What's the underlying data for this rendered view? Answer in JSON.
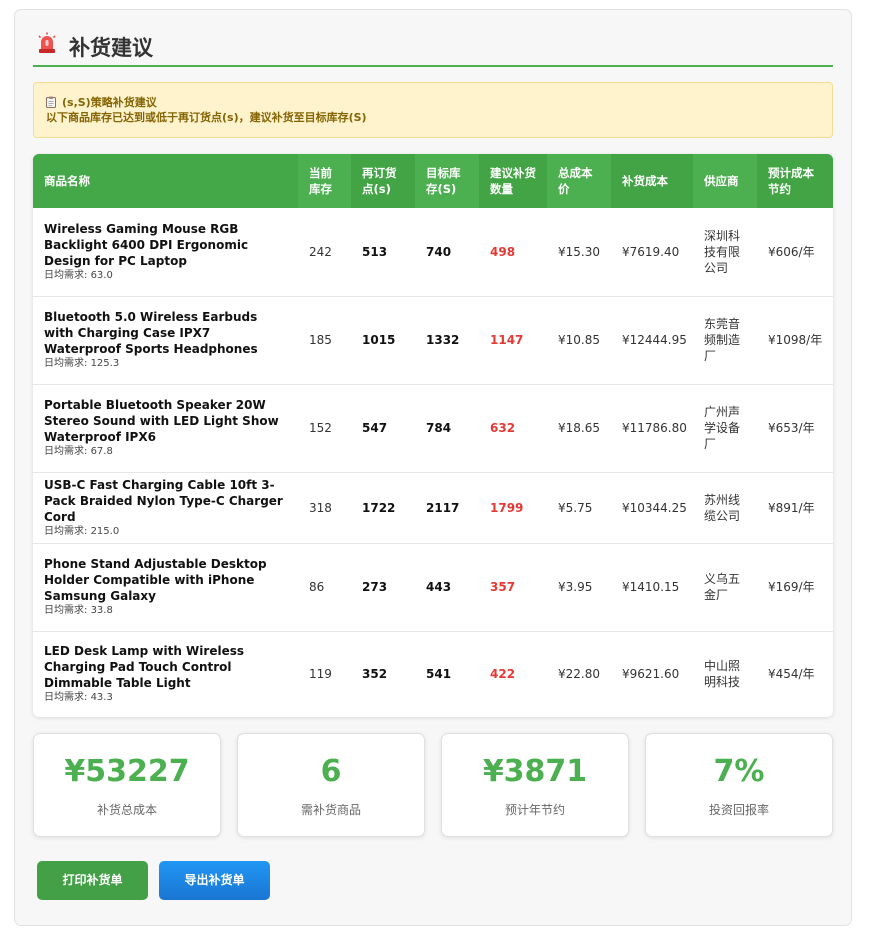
{
  "header": {
    "title": "补货建议",
    "icon": "alarm-light-icon"
  },
  "notice": {
    "icon": "clipboard-icon",
    "line1": "(s,S)策略补货建议",
    "line2": "以下商品库存已达到或低于再订货点(s)，建议补货至目标库存(S)"
  },
  "table": {
    "headers": [
      "商品名称",
      "当前库存",
      "再订货点(s)",
      "目标库存(S)",
      "建议补货数量",
      "总成本价",
      "补货成本",
      "供应商",
      "预计成本节约"
    ],
    "demand_label": "日均需求: ",
    "rows": [
      {
        "name": "Wireless Gaming Mouse RGB Backlight 6400 DPI Ergonomic Design for PC Laptop",
        "demand": "63.0",
        "current": "242",
        "reorder": "513",
        "target": "740",
        "suggest": "498",
        "unit_cost": "¥15.30",
        "cost": "¥7619.40",
        "supplier": "深圳科技有限公司",
        "saving": "¥606/年"
      },
      {
        "name": "Bluetooth 5.0 Wireless Earbuds with Charging Case IPX7 Waterproof Sports Headphones",
        "demand": "125.3",
        "current": "185",
        "reorder": "1015",
        "target": "1332",
        "suggest": "1147",
        "unit_cost": "¥10.85",
        "cost": "¥12444.95",
        "supplier": "东莞音频制造厂",
        "saving": "¥1098/年"
      },
      {
        "name": "Portable Bluetooth Speaker 20W Stereo Sound with LED Light Show Waterproof IPX6",
        "demand": "67.8",
        "current": "152",
        "reorder": "547",
        "target": "784",
        "suggest": "632",
        "unit_cost": "¥18.65",
        "cost": "¥11786.80",
        "supplier": "广州声学设备厂",
        "saving": "¥653/年"
      },
      {
        "name": "USB-C Fast Charging Cable 10ft 3-Pack Braided Nylon Type-C Charger Cord",
        "demand": "215.0",
        "current": "318",
        "reorder": "1722",
        "target": "2117",
        "suggest": "1799",
        "unit_cost": "¥5.75",
        "cost": "¥10344.25",
        "supplier": "苏州线缆公司",
        "saving": "¥891/年"
      },
      {
        "name": "Phone Stand Adjustable Desktop Holder Compatible with iPhone Samsung Galaxy",
        "demand": "33.8",
        "current": "86",
        "reorder": "273",
        "target": "443",
        "suggest": "357",
        "unit_cost": "¥3.95",
        "cost": "¥1410.15",
        "supplier": "义乌五金厂",
        "saving": "¥169/年"
      },
      {
        "name": "LED Desk Lamp with Wireless Charging Pad Touch Control Dimmable Table Light",
        "demand": "43.3",
        "current": "119",
        "reorder": "352",
        "target": "541",
        "suggest": "422",
        "unit_cost": "¥22.80",
        "cost": "¥9621.60",
        "supplier": "中山照明科技",
        "saving": "¥454/年"
      }
    ]
  },
  "summary": [
    {
      "value": "¥53227",
      "label": "补货总成本"
    },
    {
      "value": "6",
      "label": "需补货商品"
    },
    {
      "value": "¥3871",
      "label": "预计年节约"
    },
    {
      "value": "7%",
      "label": "投资回报率"
    }
  ],
  "buttons": {
    "print": "打印补货单",
    "export": "导出补货单"
  },
  "colors": {
    "accent": "#4caf50",
    "warning_bg": "#fff3cd",
    "warning_text": "#856404",
    "highlight": "#e53935",
    "export_button": "#1e88e5"
  }
}
